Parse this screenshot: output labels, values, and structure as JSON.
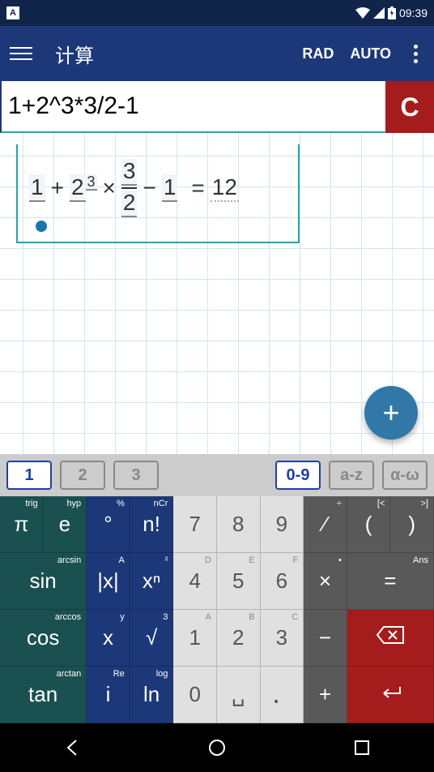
{
  "status": {
    "time": "09:39",
    "keyboard_indicator": "A"
  },
  "appbar": {
    "title": "计算",
    "rad": "RAD",
    "auto": "AUTO"
  },
  "input": {
    "expression": "1+2^3*3/2-1",
    "clear": "C"
  },
  "equation": {
    "t1": "1",
    "plus": "+",
    "t2base": "2",
    "t2exp": "3",
    "times": "×",
    "frac_num": "3",
    "frac_den": "2",
    "minus": "−",
    "t3": "1",
    "equals": "=",
    "result": "12"
  },
  "fab": {
    "label": "+"
  },
  "tabs": {
    "t1": "1",
    "t2": "2",
    "t3": "3",
    "t09": "0-9",
    "taz": "a-z",
    "tgreek": "α-ω"
  },
  "keys": {
    "pi": "π",
    "pi_sup": "trig",
    "e": "e",
    "e_sup": "hyp",
    "deg": "°",
    "deg_sup": "%",
    "nfact": "n!",
    "nfact_sup": "nCr",
    "k7": "7",
    "k8": "8",
    "k9": "9",
    "slash": "∕",
    "slash_sup": "÷",
    "lparen": "(",
    "lparen_sup": "[<",
    "rparen": ")",
    "rparen_sup": ">]",
    "sin": "sin",
    "sin_sup": "arcsin",
    "abs": "|x|",
    "abs_sup": "A",
    "xn": "xⁿ",
    "xn_sup": "²",
    "k4": "4",
    "k4_sup": "D",
    "k5": "5",
    "k5_sup": "E",
    "k6": "6",
    "k6_sup": "F",
    "times_key": "×",
    "times_sup": "•",
    "eq_key": "=",
    "eq_sup": "Ans",
    "cos": "cos",
    "cos_sup": "arccos",
    "x": "x",
    "x_sup": "y",
    "sqrt": "√",
    "sqrt_sup": "3",
    "k1": "1",
    "k1_sup": "A",
    "k2": "2",
    "k2_sup": "B",
    "k3": "3",
    "k3_sup": "C",
    "minus_key": "−",
    "tan": "tan",
    "tan_sup": "arctan",
    "i": "i",
    "i_sup": "Re",
    "ln": "ln",
    "ln_sup": "log",
    "k0": "0",
    "space": "␣",
    "dot": "．",
    "plus_key": "+"
  }
}
